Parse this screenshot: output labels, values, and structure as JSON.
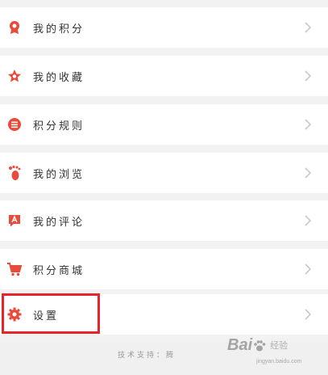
{
  "menu": {
    "items": [
      {
        "label": "我的积分",
        "icon": "points-badge-icon"
      },
      {
        "label": "我的收藏",
        "icon": "star-icon"
      },
      {
        "label": "积分规则",
        "icon": "rules-icon"
      },
      {
        "label": "我的浏览",
        "icon": "footprint-icon"
      },
      {
        "label": "我的评论",
        "icon": "comment-icon"
      },
      {
        "label": "积分商城",
        "icon": "cart-icon"
      },
      {
        "label": "设置",
        "icon": "gear-icon"
      }
    ]
  },
  "footer": {
    "support_text": "技术支持：腾"
  },
  "watermark": {
    "brand": "Bai",
    "brand2": "经验",
    "sub": "jingyan.baidu.com"
  },
  "colors": {
    "accent": "#e84b3a",
    "highlight": "#e8232a",
    "chevron": "#c8c8c8"
  }
}
